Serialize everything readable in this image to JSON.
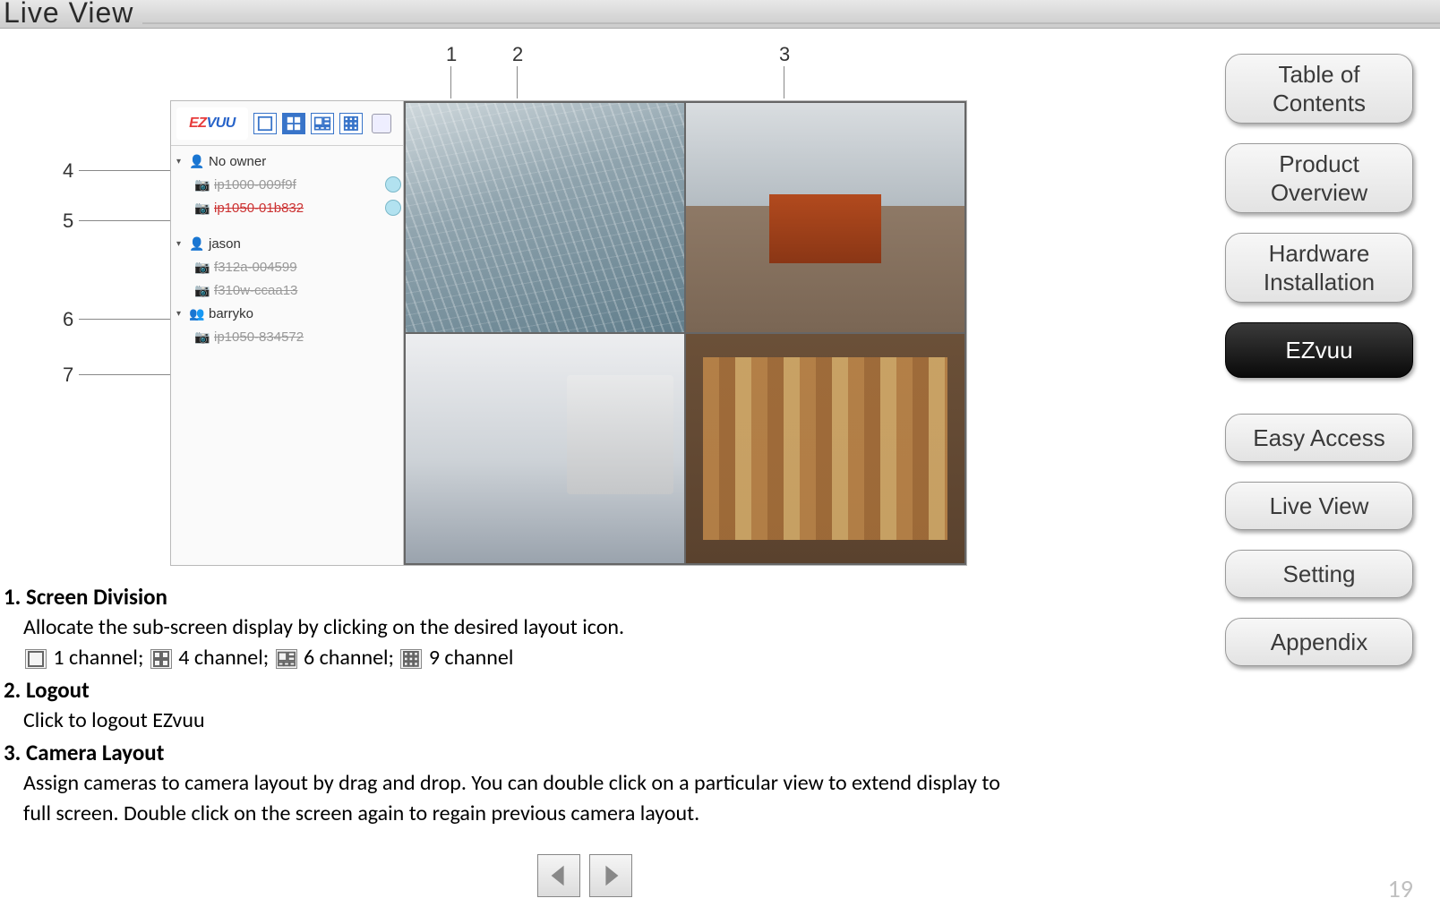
{
  "page": {
    "title": "Live View",
    "number": "19"
  },
  "sidebar_nav": {
    "items": [
      {
        "label": "Table of\nContents",
        "active": false
      },
      {
        "label": "Product\nOverview",
        "active": false
      },
      {
        "label": "Hardware\nInstallation",
        "active": false
      },
      {
        "label": "EZvuu",
        "active": true
      },
      {
        "label": "Easy Access",
        "active": false
      },
      {
        "label": "Live View",
        "active": false
      },
      {
        "label": "Setting",
        "active": false
      },
      {
        "label": "Appendix",
        "active": false
      }
    ]
  },
  "callouts": {
    "top": {
      "c1": "1",
      "c2": "2",
      "c3": "3"
    },
    "left": {
      "c4": "4",
      "c5": "5",
      "c6": "6",
      "c7": "7"
    }
  },
  "app": {
    "logo": {
      "ez": "EZ",
      "vuu": "VUU"
    },
    "tree": {
      "g1_name": "No owner",
      "g1_cam1": "ip1000-009f9f",
      "g1_cam2": "ip1050-01b832",
      "g2_name": "jason",
      "g2_cam1": "f312a-004599",
      "g2_cam2": "f310w-ccaa13",
      "g3_name": "barryko",
      "g3_cam1": "ip1050-834572"
    }
  },
  "desc": {
    "h1": "1. Screen Division",
    "p1": "Allocate the sub-screen display by clicking on the desired layout icon.",
    "ch1": " 1 channel;  ",
    "ch4": " 4 channel;   ",
    "ch6": " 6 channel;  ",
    "ch9": " 9 channel",
    "h2": "2. Logout",
    "p2": "Click to logout EZvuu",
    "h3": "3. Camera Layout",
    "p3": "Assign cameras to camera layout by drag and drop. You can double click on a particular view to extend display to full screen. Double click on the screen again to regain previous camera layout."
  }
}
